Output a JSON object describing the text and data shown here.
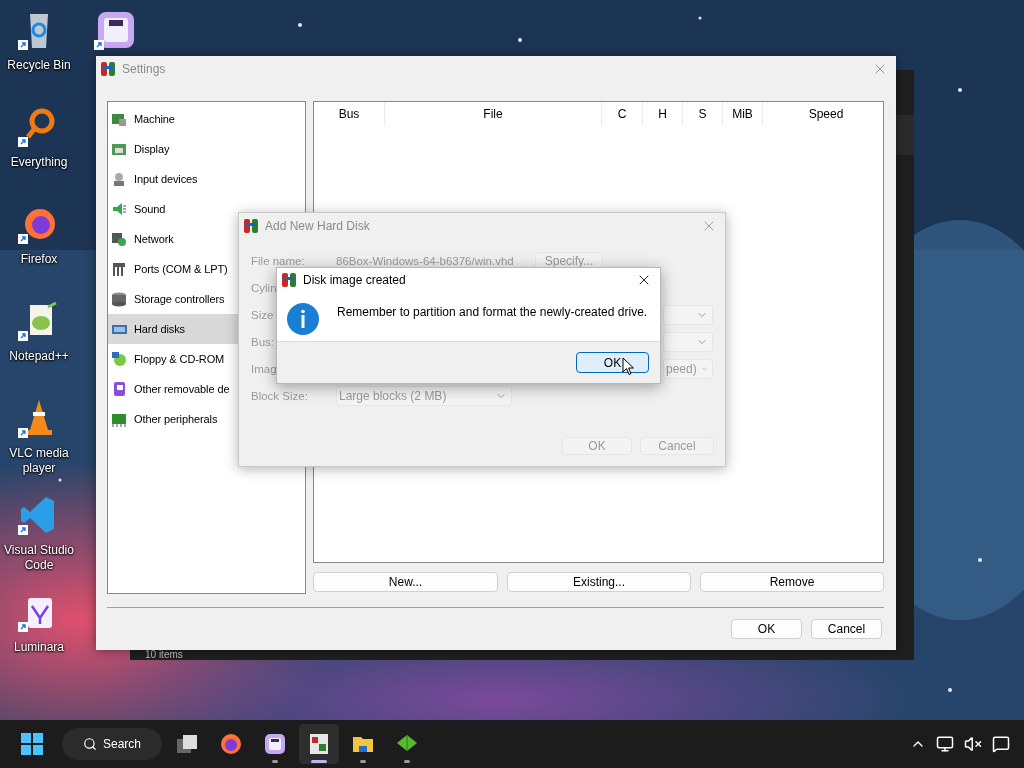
{
  "desktop": {
    "icons": [
      {
        "label": "Recycle Bin",
        "kind": "recycle"
      },
      {
        "label": "Everything",
        "kind": "everything"
      },
      {
        "label": "Firefox",
        "kind": "firefox"
      },
      {
        "label": "Notepad++",
        "kind": "notepad"
      },
      {
        "label": "VLC media player",
        "kind": "vlc"
      },
      {
        "label": "Visual Studio Code",
        "kind": "vscode"
      },
      {
        "label": "Luminara",
        "kind": "luminara"
      }
    ]
  },
  "background_window": {
    "status": "10 items"
  },
  "settings": {
    "title": "Settings",
    "categories": [
      {
        "label": "Machine",
        "kind": "machine",
        "selected": false
      },
      {
        "label": "Display",
        "kind": "display",
        "selected": false
      },
      {
        "label": "Input devices",
        "kind": "input",
        "selected": false
      },
      {
        "label": "Sound",
        "kind": "sound",
        "selected": false
      },
      {
        "label": "Network",
        "kind": "network",
        "selected": false
      },
      {
        "label": "Ports (COM & LPT)",
        "kind": "ports",
        "selected": false
      },
      {
        "label": "Storage controllers",
        "kind": "storage",
        "selected": false
      },
      {
        "label": "Hard disks",
        "kind": "harddisk",
        "selected": true
      },
      {
        "label": "Floppy & CD-ROM",
        "kind": "floppy",
        "selected": false
      },
      {
        "label": "Other removable de",
        "kind": "removable",
        "selected": false
      },
      {
        "label": "Other peripherals",
        "kind": "peripherals",
        "selected": false
      }
    ],
    "table": {
      "columns": [
        "Bus",
        "File",
        "C",
        "H",
        "S",
        "MiB",
        "Speed"
      ]
    },
    "actions": [
      "New...",
      "Existing...",
      "Remove"
    ],
    "buttons": [
      "OK",
      "Cancel"
    ]
  },
  "add_disk_dialog": {
    "title": "Add New Hard Disk",
    "disabled": true,
    "fields": [
      {
        "label": "File name:",
        "kind": "path",
        "value": "86Box-Windows-64-b6376/win.vhd",
        "button": "Specify..."
      },
      {
        "label": "Cylin",
        "kind": "blank"
      },
      {
        "label": "Size",
        "kind": "dropdown"
      },
      {
        "label": "Bus:",
        "kind": "dropdown"
      },
      {
        "label": "Imag",
        "kind": "dropdown",
        "value": "peed)"
      },
      {
        "label": "Block Size:",
        "kind": "select",
        "value": "Large blocks (2 MB)"
      }
    ],
    "buttons": [
      "OK",
      "Cancel"
    ]
  },
  "message_box": {
    "title": "Disk image created",
    "message": "Remember to partition and format the newly-created drive.",
    "button": {
      "label": "OK",
      "focused": true
    }
  },
  "taskbar": {
    "search": "Search",
    "apps": [
      {
        "kind": "taskview",
        "running": false,
        "active": false
      },
      {
        "kind": "firefox",
        "running": false,
        "active": false
      },
      {
        "kind": "floppyapp",
        "running": true,
        "active": false
      },
      {
        "kind": "emulator",
        "running": true,
        "active": true
      },
      {
        "kind": "folder",
        "running": true,
        "active": false
      },
      {
        "kind": "gem",
        "running": true,
        "active": false
      }
    ]
  }
}
